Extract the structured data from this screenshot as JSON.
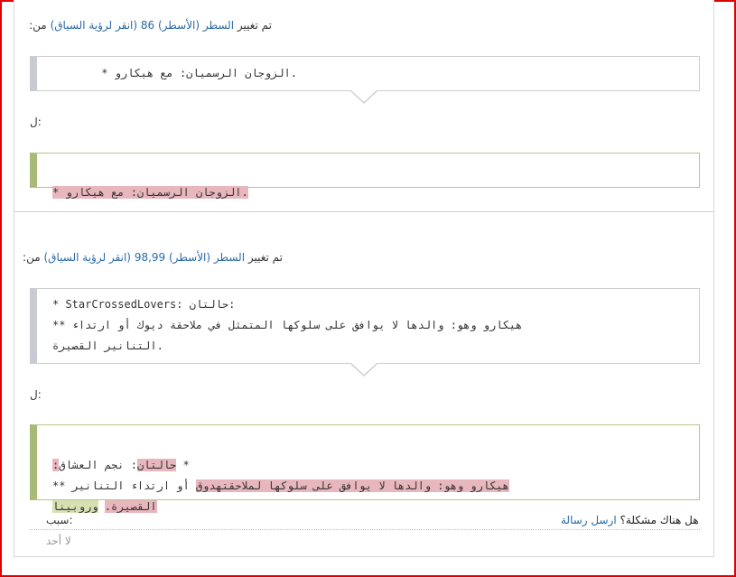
{
  "change1": {
    "heading_prefix": "تم تغيير",
    "heading_link": "السطر (الأسطر) 86",
    "heading_context": "(انقر لرؤية السياق)",
    "heading_suffix": "من:",
    "old_line": ".الزوجان الرسميان: مع هيكارو *",
    "to_label": "ل:",
    "new_line": ".الزوجان الرسميان: مع هيكارو *"
  },
  "change2": {
    "heading_prefix": "تم تغيير",
    "heading_link": "السطر (الأسطر) 98,99",
    "heading_context": "(انقر لرؤية السياق)",
    "heading_suffix": "من:",
    "old_lines": [
      "* StarCrossedLovers: حالتان:",
      "هيكارو وهو: والدها لا يوافق على سلوكها المتمثل في ملاحقة ديوك أو ارتداء **",
      ".التنانير القصيرة"
    ],
    "to_label": "ل:",
    "new_line1": {
      "plain": "* ",
      "del1": "حالتان",
      "mid": ": نجم العشاق",
      "del2": ":"
    },
    "new_line2": {
      "del": "هيكارو وهو: والدها لا يوافق على سلوكها لملاحقتهدوق",
      "plain": " أو ارتداء التنانير **"
    },
    "new_line3": {
      "del": "القصيرة.",
      "plain": " ",
      "add": "وروبينا"
    }
  },
  "footer": {
    "problem_text": "هل هناك مشكلة؟",
    "send_message": "ارسل رسالة",
    "reason_label": "سبب:",
    "reason_value": "لا أحد"
  }
}
